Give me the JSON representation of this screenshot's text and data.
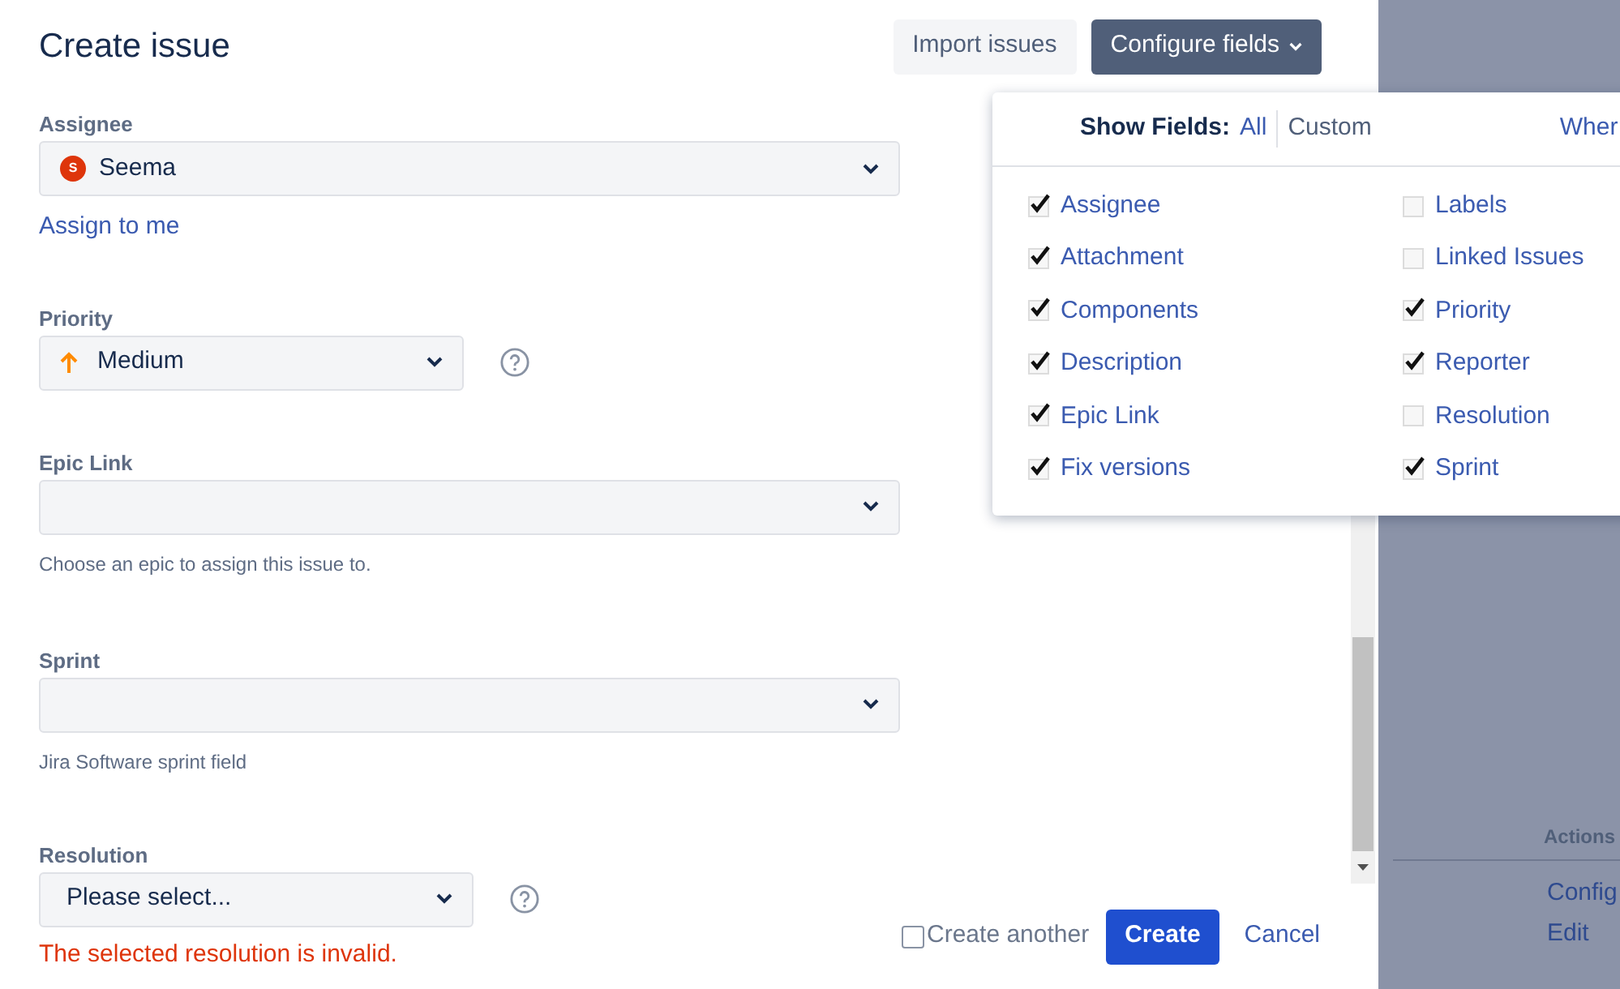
{
  "dialog": {
    "title": "Create issue",
    "header_buttons": [
      {
        "label": "Import issues",
        "kind": "secondary"
      },
      {
        "label": "Configure fields",
        "kind": "primary"
      }
    ]
  },
  "fields": [
    {
      "label": "Assignee",
      "kind": "user",
      "value": "Seema",
      "avatar_letter": "S",
      "link": "Assign to me"
    },
    {
      "label": "Priority",
      "kind": "priority",
      "value": "Medium",
      "help": true
    },
    {
      "label": "Epic Link",
      "kind": "select",
      "hint": "Choose an epic to assign this issue to."
    },
    {
      "label": "Sprint",
      "kind": "select",
      "hint": "Jira Software sprint field"
    },
    {
      "label": "Resolution",
      "kind": "select",
      "value": "Please select...",
      "help": true,
      "error": "The selected resolution is invalid."
    }
  ],
  "footer": {
    "create_another": {
      "label": "Create another",
      "checked": false
    },
    "create": "Create",
    "cancel": "Cancel"
  },
  "configure_popup": {
    "show_fields_label": "Show Fields:",
    "modes": [
      {
        "label": "All",
        "selected": false
      },
      {
        "label": "Custom",
        "selected": true
      }
    ],
    "cut_link": "Wher",
    "columns": [
      [
        {
          "label": "Assignee",
          "checked": true
        },
        {
          "label": "Attachment",
          "checked": true
        },
        {
          "label": "Components",
          "checked": true
        },
        {
          "label": "Description",
          "checked": true
        },
        {
          "label": "Epic Link",
          "checked": true
        },
        {
          "label": "Fix versions",
          "checked": true
        }
      ],
      [
        {
          "label": "Labels",
          "checked": false
        },
        {
          "label": "Linked Issues",
          "checked": false
        },
        {
          "label": "Priority",
          "checked": true
        },
        {
          "label": "Reporter",
          "checked": true
        },
        {
          "label": "Resolution",
          "checked": false
        },
        {
          "label": "Sprint",
          "checked": true
        }
      ]
    ]
  },
  "background": {
    "actions_heading": "Actions",
    "links": [
      "Config",
      "Edit"
    ]
  }
}
